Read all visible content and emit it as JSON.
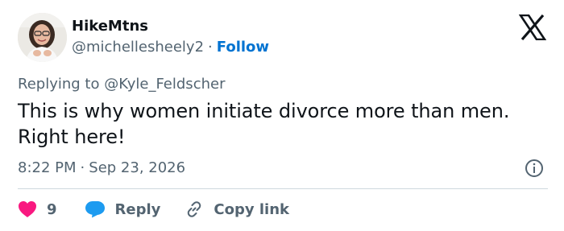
{
  "tweet": {
    "display_name": "HikeMtns",
    "handle": "@michellesheely2",
    "separator": "·",
    "follow_label": "Follow",
    "replying_to_prefix": "Replying to",
    "replying_to_handle": "@Kyle_Feldscher",
    "text": "This is why women initiate divorce more than men.\nRight here!",
    "time": "8:22 PM",
    "date": "Sep 23, 2026"
  },
  "actions": {
    "like_count": "9",
    "reply_label": "Reply",
    "copy_link_label": "Copy link"
  },
  "colors": {
    "link_blue": "#0073d1",
    "like_red": "#f91880",
    "reply_blue": "#1d9bf0",
    "secondary_text": "#536471",
    "primary_text": "#0f1419"
  },
  "icons": {
    "logo": "x-logo-icon",
    "info": "info-icon",
    "like": "heart-icon",
    "reply": "speech-bubble-icon",
    "copy": "link-icon"
  }
}
